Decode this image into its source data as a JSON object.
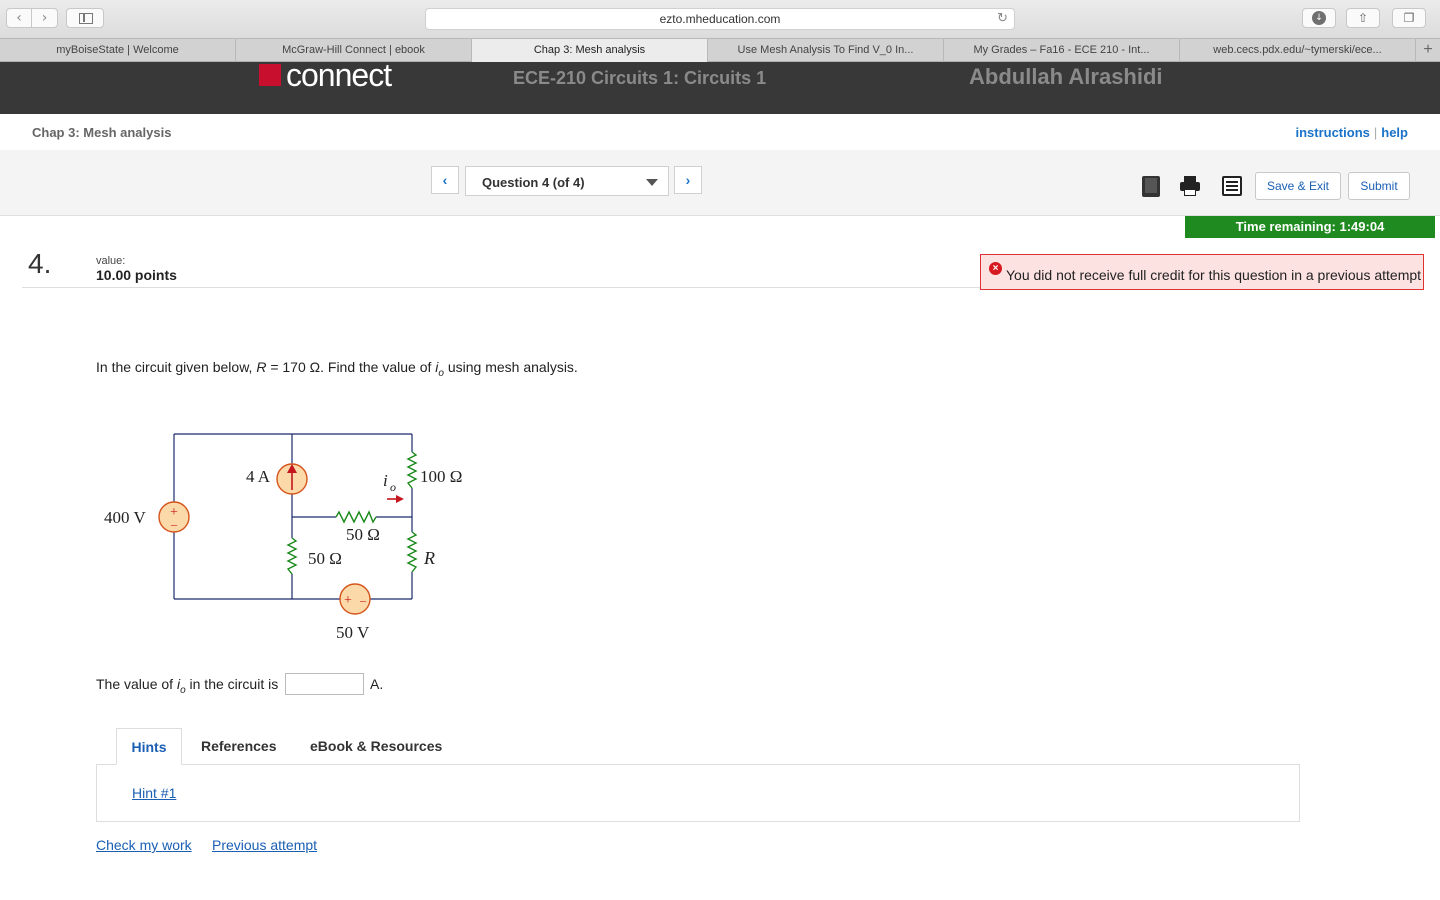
{
  "browser": {
    "url": "ezto.mheducation.com",
    "tabs": [
      {
        "label": "myBoiseState | Welcome"
      },
      {
        "label": "McGraw-Hill Connect | ebook"
      },
      {
        "label": "Chap 3: Mesh analysis"
      },
      {
        "label": "Use Mesh Analysis To Find V_0 In..."
      },
      {
        "label": "My Grades – Fa16 - ECE 210 - Int..."
      },
      {
        "label": "web.cecs.pdx.edu/~tymerski/ece..."
      }
    ],
    "active_tab": 2
  },
  "header": {
    "logo_text": "connect",
    "logo_badge": "Mc Graw Hill Education",
    "course": "ECE-210 Circuits 1: Circuits 1",
    "user": "Abdullah Alrashidi"
  },
  "assignment": {
    "title": "Chap 3: Mesh analysis",
    "instructions": "instructions",
    "help": "help"
  },
  "question_nav": {
    "selected": "Question 4 (of 4)",
    "save_exit": "Save & Exit",
    "submit": "Submit"
  },
  "timer": "Time remaining: 1:49:04",
  "question": {
    "number": "4.",
    "value_label": "value:",
    "points": "10.00 points",
    "alert": "You did not receive full credit for this question in a previous attempt",
    "prompt_a": "In the circuit given below, ",
    "prompt_r": "R",
    "prompt_b": " = 170 Ω. Find the value of ",
    "prompt_i": "i",
    "prompt_sub": "o",
    "prompt_c": " using mesh analysis.",
    "answer_a": "The value of ",
    "answer_b": " in the circuit is",
    "answer_unit": "A.",
    "answer_value": ""
  },
  "circuit": {
    "source_v": "400 V",
    "source_i": "4 A",
    "r_top_right": "100 Ω",
    "r_mid": "50 Ω",
    "r_left": "50 Ω",
    "r_right": "R",
    "source_bottom": "50 V",
    "current_label": "i",
    "current_sub": "o",
    "plus": "+",
    "minus": "–"
  },
  "hints": {
    "tabs": [
      "Hints",
      "References",
      "eBook & Resources"
    ],
    "hint1": "Hint #1"
  },
  "footer": {
    "check": "Check my work",
    "previous": "Previous attempt"
  },
  "colors": {
    "header_bg": "#383838",
    "timer_bg": "#1f8a1f",
    "link": "#1a5fb4",
    "alert_bg": "#fde2e2",
    "resistor": "#1a8a1a",
    "source_fill": "#fcd9a8",
    "source_stroke": "#d4541b"
  }
}
